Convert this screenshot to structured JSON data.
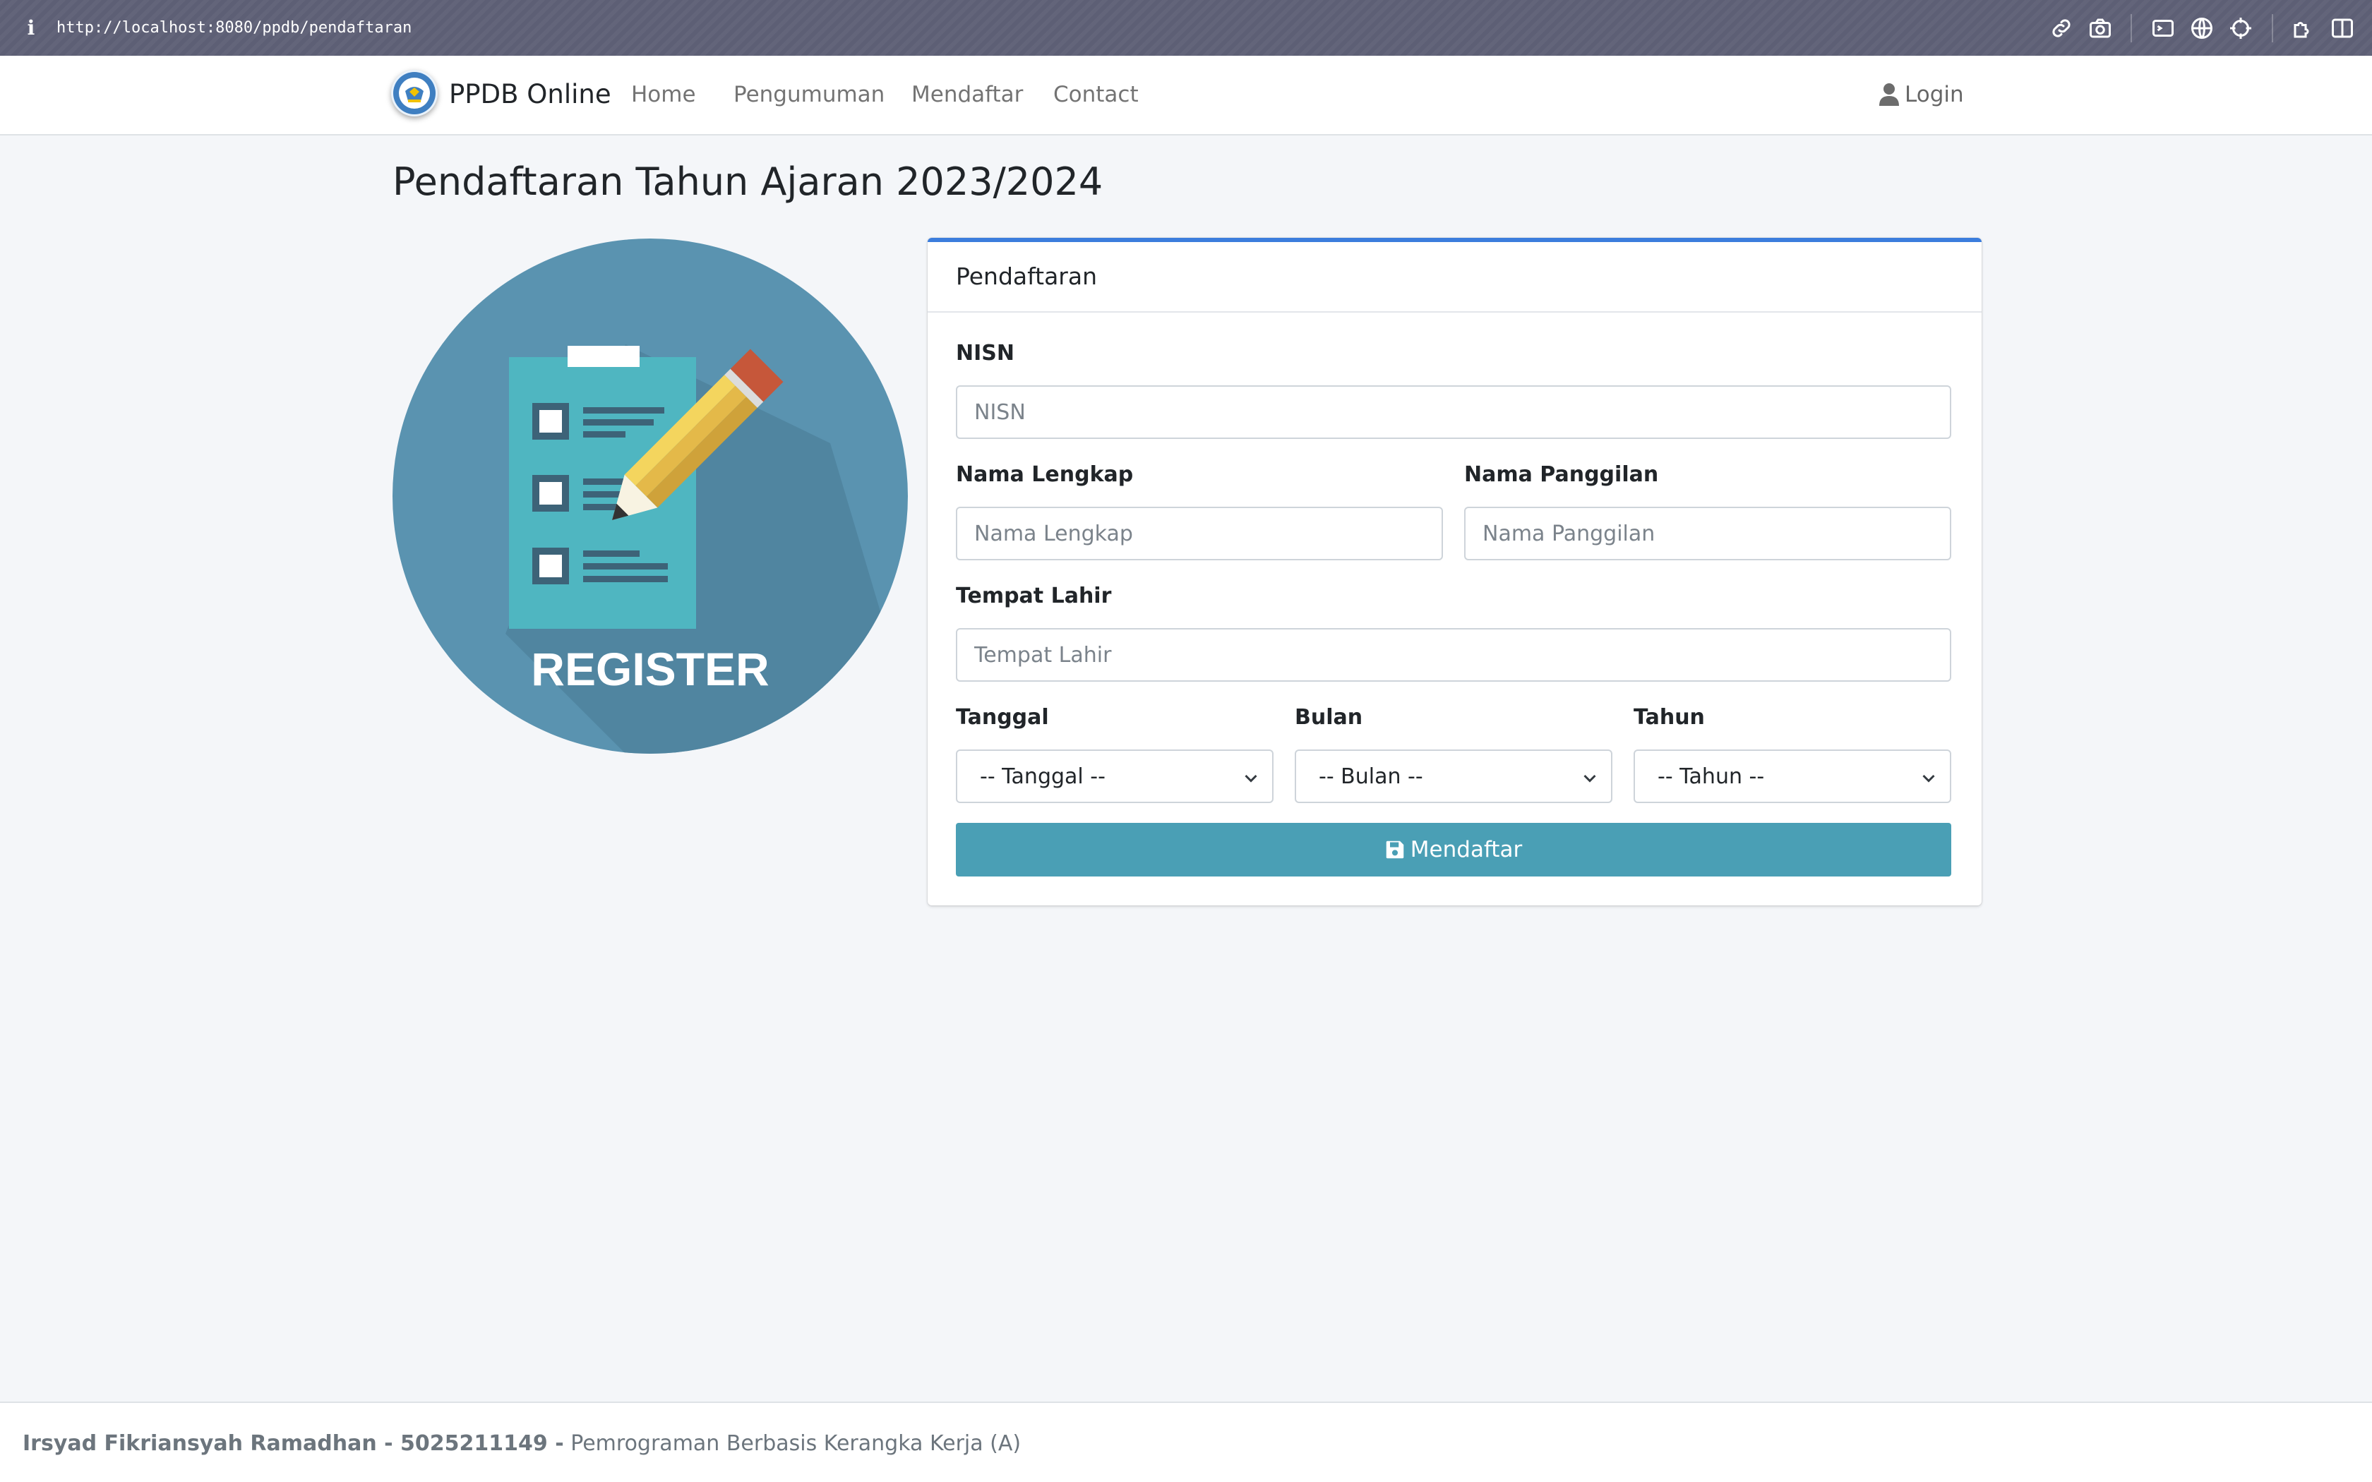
{
  "browser": {
    "url": "http://localhost:8080/ppdb/pendaftaran",
    "toolbar_icons": [
      "link-icon",
      "camera-icon",
      "terminal-icon",
      "globe-icon",
      "crosshair-icon",
      "extensions-icon",
      "sidebar-icon"
    ]
  },
  "navbar": {
    "brand": "PPDB Online",
    "links": [
      "Home",
      "Pengumuman",
      "Mendaftar",
      "Contact"
    ],
    "login": "Login"
  },
  "page": {
    "title": "Pendaftaran Tahun Ajaran 2023/2024",
    "illustration_text": "REGISTER"
  },
  "form": {
    "header": "Pendaftaran",
    "nisn": {
      "label": "NISN",
      "placeholder": "NISN",
      "value": ""
    },
    "nama_lengkap": {
      "label": "Nama Lengkap",
      "placeholder": "Nama Lengkap",
      "value": ""
    },
    "nama_panggilan": {
      "label": "Nama Panggilan",
      "placeholder": "Nama Panggilan",
      "value": ""
    },
    "tempat_lahir": {
      "label": "Tempat Lahir",
      "placeholder": "Tempat Lahir",
      "value": ""
    },
    "tanggal": {
      "label": "Tanggal",
      "selected": "-- Tanggal --"
    },
    "bulan": {
      "label": "Bulan",
      "selected": "-- Bulan --"
    },
    "tahun": {
      "label": "Tahun",
      "selected": "-- Tahun --"
    },
    "submit": "Mendaftar"
  },
  "footer": {
    "author": "Irsyad Fikriansyah Ramadhan - 5025211149 -",
    "course": "Pemrograman Berbasis Kerangka Kerja (A)"
  },
  "colors": {
    "accent": "#3b7ddd",
    "button": "#4a9fb5",
    "illustration_bg": "#5a93b0"
  }
}
